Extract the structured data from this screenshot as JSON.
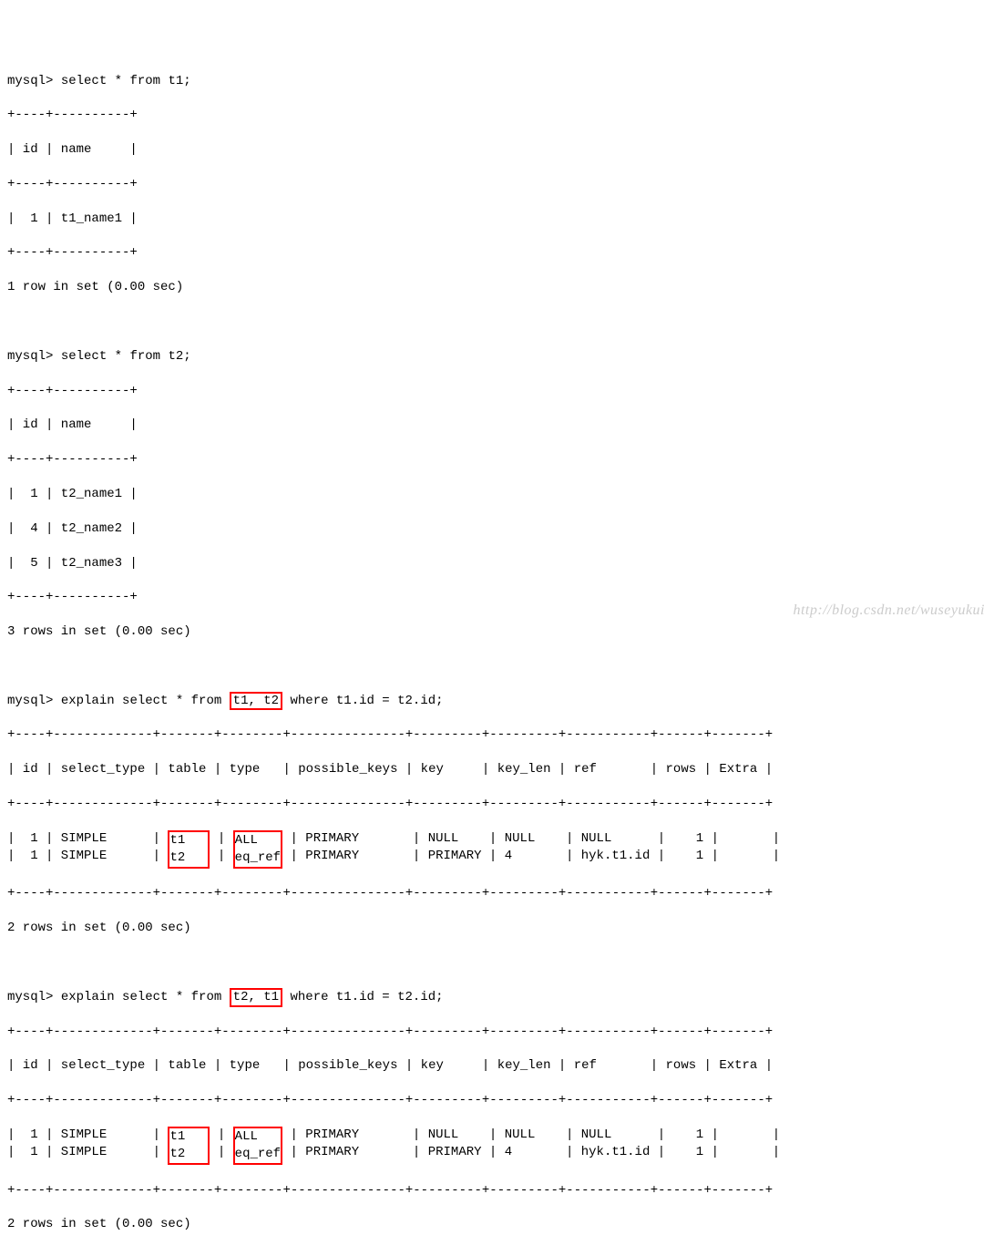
{
  "prompt": "mysql>",
  "queries": {
    "q1": "select * from t1;",
    "q2": "select * from t2;",
    "q3a": "explain select * from ",
    "q3_hl": "t1, t2",
    "q3b": " where t1.id = t2.id;",
    "q4a": "explain select * from ",
    "q4_hl": "t2, t1",
    "q4b": " where t1.id = t2.id;"
  },
  "t1_border": "+----+----------+",
  "t1_header": "| id | name     |",
  "t1_rows": {
    "r1": "|  1 | t1_name1 |"
  },
  "t1_footer": "1 row in set (0.00 sec)",
  "t2_border": "+----+----------+",
  "t2_header": "| id | name     |",
  "t2_rows": {
    "r1": "|  1 | t2_name1 |",
    "r2": "|  4 | t2_name2 |",
    "r3": "|  5 | t2_name3 |"
  },
  "t2_footer": "3 rows in set (0.00 sec)",
  "explain_border": "+----+-------------+-------+--------+---------------+---------+---------+-----------+------+-------+",
  "explain_header": "| id | select_type | table | type   | possible_keys | key     | key_len | ref       | rows | Extra |",
  "explain1": {
    "row_prefix": {
      "r1": "|  1 | SIMPLE      | ",
      "r2": "|  1 | SIMPLE      | "
    },
    "table_col": {
      "r1": "t1   ",
      "r2": "t2   "
    },
    "mid": " | ",
    "type_col": {
      "r1": "ALL   ",
      "r2": "eq_ref"
    },
    "row_suffix": {
      "r1": " | PRIMARY       | NULL    | NULL    | NULL      |    1 |       |",
      "r2": " | PRIMARY       | PRIMARY | 4       | hyk.t1.id |    1 |       |"
    }
  },
  "explain2": {
    "row_prefix": {
      "r1": "|  1 | SIMPLE      | ",
      "r2": "|  1 | SIMPLE      | "
    },
    "table_col": {
      "r1": "t1   ",
      "r2": "t2   "
    },
    "mid": " | ",
    "type_col": {
      "r1": "ALL   ",
      "r2": "eq_ref"
    },
    "row_suffix": {
      "r1": " | PRIMARY       | NULL    | NULL    | NULL      |    1 |       |",
      "r2": " | PRIMARY       | PRIMARY | 4       | hyk.t1.id |    1 |       |"
    }
  },
  "explain_footer": "2 rows in set (0.00 sec)",
  "watermark": "http://blog.csdn.net/wuseyukui"
}
